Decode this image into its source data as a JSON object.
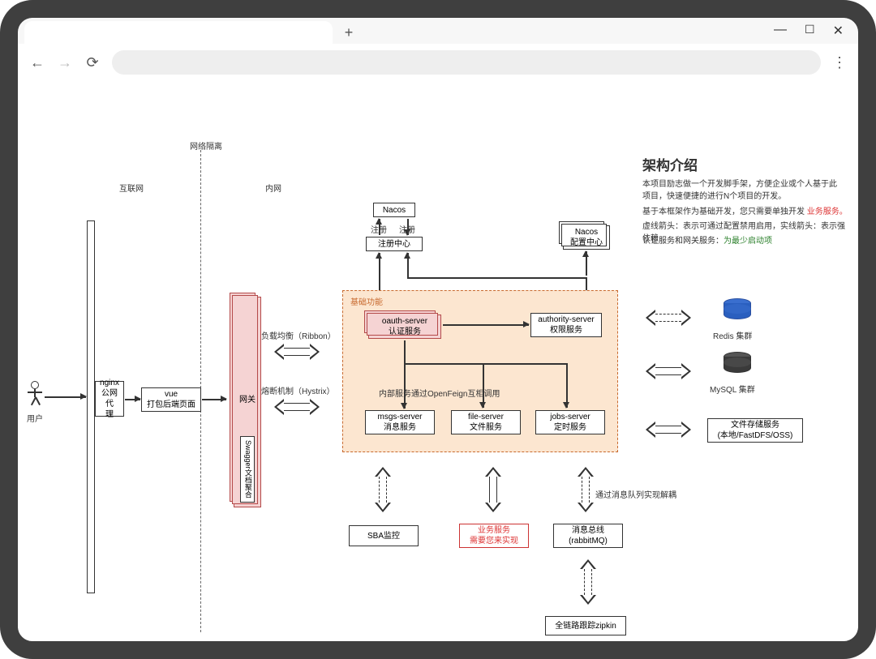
{
  "labels": {
    "network_isolation": "网络隔离",
    "internet": "互联网",
    "intranet": "内网",
    "user": "用户",
    "nginx_l1": "nginx",
    "nginx_l2": "公网代",
    "nginx_l3": "理",
    "vue_l1": "vue",
    "vue_l2": "打包后端页面",
    "gateway": "网关",
    "swagger": "Swagger文档聚合",
    "ribbon": "负载均衡（Ribbon）",
    "hystrix": "熔断机制（Hystrix）",
    "nacos": "Nacos",
    "register": "注册",
    "register_center": "注册中心",
    "nacos_config_l1": "Nacos",
    "nacos_config_l2": "配置中心",
    "base_func": "基础功能",
    "oauth_l1": "oauth-server",
    "oauth_l2": "认证服务",
    "authority_l1": "authority-server",
    "authority_l2": "权限服务",
    "feign": "内部服务通过OpenFeign互相调用",
    "msgs_l1": "msgs-server",
    "msgs_l2": "消息服务",
    "file_l1": "file-server",
    "file_l2": "文件服务",
    "jobs_l1": "jobs-server",
    "jobs_l2": "定时服务",
    "sba": "SBA监控",
    "biz_l1": "业务服务",
    "biz_l2": "需要您来实现",
    "bus_l1": "消息总线",
    "bus_l2": "(rabbitMQ)",
    "mq_decouple": "通过消息队列实现解耦",
    "zipkin": "全链路跟踪zipkin",
    "redis": "Redis 集群",
    "mysql": "MySQL 集群",
    "storage_l1": "文件存储服务",
    "storage_l2": "(本地/FastDFS/OSS)"
  },
  "text": {
    "title": "架构介绍",
    "p1": "本项目励志做一个开发脚手架，方便企业或个人基于此项目，快速便捷的进行N个项目的开发。",
    "p2a": "基于本框架作为基础开发，您只需要单独开发 ",
    "p2b": "业务服务。",
    "p3": "虚线箭头：表示可通过配置禁用启用，实线箭头：表示强依赖",
    "p4a": "认证服务和网关服务：",
    "p4b": "为最少启动项"
  }
}
